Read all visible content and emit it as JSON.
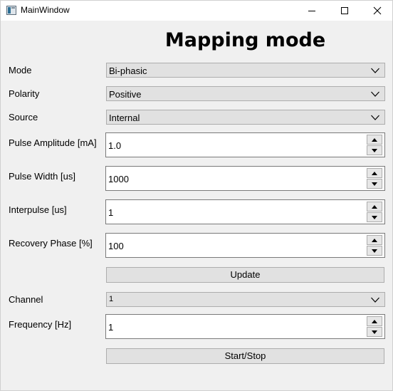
{
  "window": {
    "title": "MainWindow",
    "controls": [
      "minimize-icon",
      "maximize-icon",
      "close-icon"
    ]
  },
  "heading": "Mapping mode",
  "fields": {
    "mode": {
      "label": "Mode",
      "value": "Bi-phasic"
    },
    "polarity": {
      "label": "Polarity",
      "value": "Positive"
    },
    "source": {
      "label": "Source",
      "value": "Internal"
    },
    "pulse_amplitude": {
      "label": "Pulse Amplitude [mA]",
      "value": "1.0"
    },
    "pulse_width": {
      "label": "Pulse Width [us]",
      "value": "1000"
    },
    "interpulse": {
      "label": "Interpulse [us]",
      "value": "1"
    },
    "recovery_phase": {
      "label": "Recovery Phase [%]",
      "value": "100"
    },
    "channel": {
      "label": "Channel",
      "value": "1"
    },
    "frequency": {
      "label": "Frequency [Hz]",
      "value": "1"
    }
  },
  "buttons": {
    "update": "Update",
    "start_stop": "Start/Stop"
  }
}
